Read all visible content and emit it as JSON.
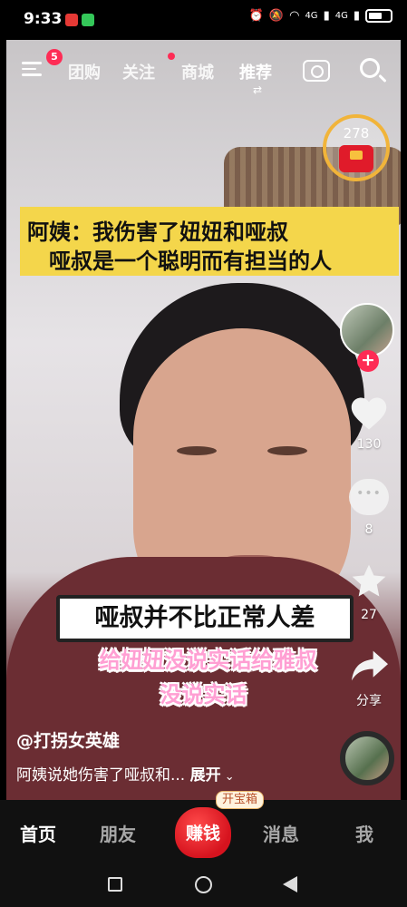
{
  "status_bar": {
    "time": "9:33",
    "signal_labels": [
      "4G",
      "4G"
    ],
    "icons": [
      "alarm-icon",
      "mute-icon",
      "wifi-icon",
      "signal-icon",
      "signal-icon",
      "battery-icon"
    ],
    "notification_colors": [
      "#e53935",
      "#34c759"
    ]
  },
  "top_nav": {
    "menu_badge": "5",
    "tabs": [
      "团购",
      "关注",
      "商城",
      "推荐"
    ],
    "active_tab": "推荐",
    "swap_glyph": "⇄"
  },
  "coin_widget": {
    "count": "278"
  },
  "captions": {
    "top_line1": "阿姨：我伤害了妞妞和哑叔",
    "top_line2": "哑叔是一个聪明而有担当的人",
    "middle": "哑叔并不比正常人差",
    "pink_line1": "给妞妞没说实话给雅叔",
    "pink_line2": "没说实话"
  },
  "right_rail": {
    "likes": "130",
    "comments": "8",
    "favorites": "27",
    "share_label": "分享",
    "follow_glyph": "+"
  },
  "video_info": {
    "author": "@打拐女英雄",
    "description": "阿姨说她伤害了哑叔和...",
    "expand_label": "展开"
  },
  "bottom_tabs": {
    "home": "首页",
    "friends": "朋友",
    "earn": "赚钱",
    "treasure_badge": "开宝箱",
    "messages": "消息",
    "me": "我"
  },
  "colors": {
    "accent": "#fe2c55",
    "caption_yellow": "#f4d64b",
    "caption_pink": "#ff9fd3",
    "coin_ring": "#f1b43a"
  }
}
